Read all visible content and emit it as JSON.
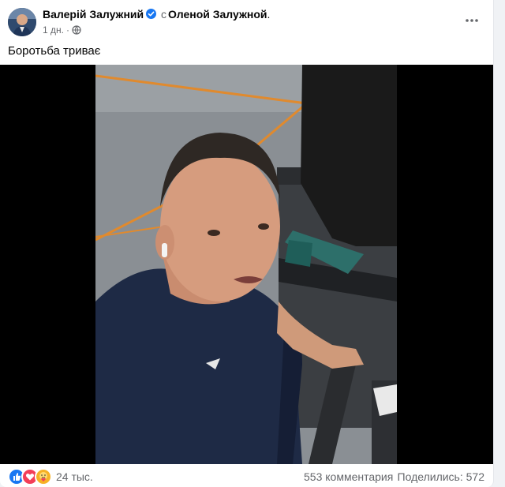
{
  "post": {
    "author": "Валерій Залужний",
    "with_word": "с",
    "tagged": "Оленой Залужной",
    "time": "1 дн.",
    "text": "Боротьба триває"
  },
  "footer": {
    "reaction_count": "24 тыс.",
    "comments": "553 комментария",
    "shares": "Поделились: 572"
  },
  "colors": {
    "accent": "#1877f2",
    "love": "#f33e58",
    "care": "#f7b125"
  },
  "icons": {
    "verified": "verified-badge-icon",
    "audience": "globe-icon",
    "more": "more-dots-icon",
    "reactions": [
      "like-reaction-icon",
      "love-reaction-icon",
      "care-reaction-icon"
    ]
  }
}
